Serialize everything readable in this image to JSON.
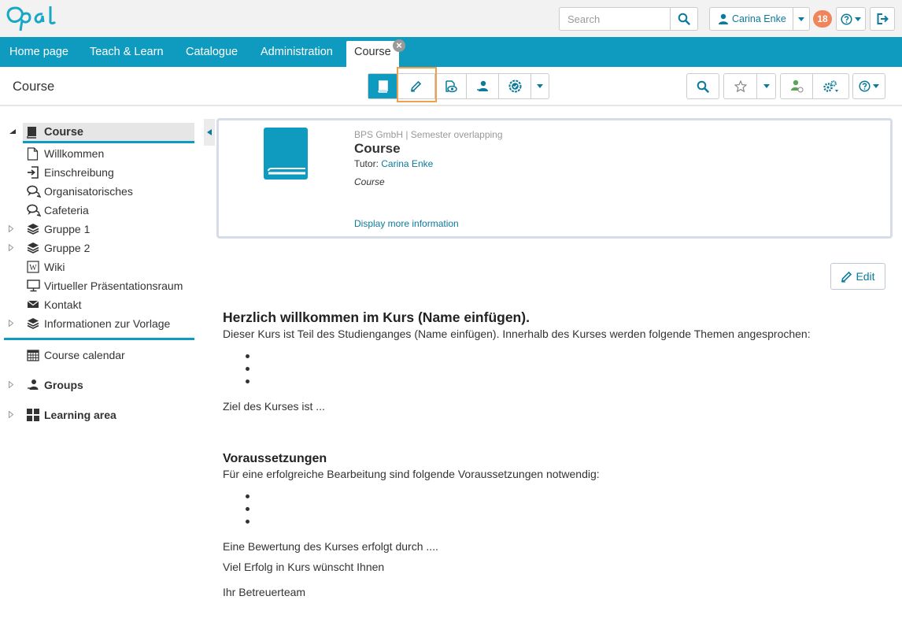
{
  "header": {
    "logo_text": "Opal",
    "search_placeholder": "Search",
    "user_name": "Carina Enke",
    "notification_count": "18"
  },
  "nav": {
    "tabs": [
      {
        "label": "Home page"
      },
      {
        "label": "Teach & Learn"
      },
      {
        "label": "Catalogue"
      },
      {
        "label": "Administration"
      },
      {
        "label": "Course"
      }
    ],
    "close_symbol": "×"
  },
  "toolbar": {
    "title": "Course"
  },
  "sidebar": {
    "root_label": "Course",
    "items": [
      {
        "label": "Willkommen",
        "icon": "page-icon"
      },
      {
        "label": "Einschreibung",
        "icon": "enrollment-icon"
      },
      {
        "label": "Organisatorisches",
        "icon": "forum-icon"
      },
      {
        "label": "Cafeteria",
        "icon": "forum-icon"
      },
      {
        "label": "Gruppe 1",
        "icon": "layers-icon"
      },
      {
        "label": "Gruppe 2",
        "icon": "layers-icon"
      },
      {
        "label": "Wiki",
        "icon": "wiki-icon"
      },
      {
        "label": "Virtueller Präsentationsraum",
        "icon": "monitor-icon"
      },
      {
        "label": "Kontakt",
        "icon": "envelope-icon"
      },
      {
        "label": "Informationen zur Vorlage",
        "icon": "layers-icon"
      }
    ],
    "calendar_label": "Course calendar",
    "groups_label": "Groups",
    "learning_area_label": "Learning area"
  },
  "info": {
    "org": "BPS GmbH | Semester overlapping",
    "title": "Course",
    "tutor_label": "Tutor:",
    "tutor_name": "Carina Enke",
    "type": "Course",
    "more_link": "Display more information"
  },
  "edit_label": "Edit",
  "content": {
    "heading": "Herzlich willkommen im Kurs (Name einfügen).",
    "intro": "Dieser Kurs ist Teil des Studienganges (Name einfügen). Innerhalb des Kurses werden folgende Themen angesprochen:",
    "goal": "Ziel des Kurses ist ...",
    "prereq_heading": "Voraussetzungen",
    "prereq_text": "Für eine erfolgreiche Bearbeitung sind folgende Voraussetzungen notwendig:",
    "evaluation": "Eine Bewertung des Kurses erfolgt durch ....",
    "wish": "Viel Erfolg in Kurs wünscht Ihnen",
    "sign": "Ihr Betreuerteam"
  },
  "colors": {
    "accent": "#0e9bbf",
    "link": "#0b7a9b",
    "badge": "#f0845c",
    "highlight": "#f0a04b"
  }
}
